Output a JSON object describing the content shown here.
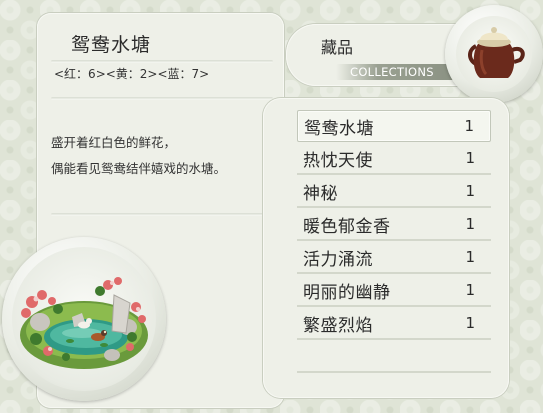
{
  "detail": {
    "title": "鸳鸯水塘",
    "stats": "<红：6><黄：2><蓝：7>",
    "description_line1": "盛开着红白色的鲜花，",
    "description_line2": "偶能看见鸳鸯结伴嬉戏的水塘。",
    "image_icon": "mandarin-duck-pond-illustration"
  },
  "collections": {
    "title": "藏品",
    "subtitle": "COLLECTIONS",
    "icon": "teapot-jar-icon"
  },
  "items": [
    {
      "name": "鸳鸯水塘",
      "count": "1",
      "selected": true
    },
    {
      "name": "热忱天使",
      "count": "1"
    },
    {
      "name": "神秘",
      "count": "1"
    },
    {
      "name": "暖色郁金香",
      "count": "1"
    },
    {
      "name": "活力涌流",
      "count": "1"
    },
    {
      "name": "明丽的幽静",
      "count": "1"
    },
    {
      "name": "繁盛烈焰",
      "count": "1"
    }
  ],
  "colors": {
    "background": "#dfe4d6",
    "panel": "#eef0e8",
    "jar": "#6b2a1c",
    "jar_lid": "#efe6c8"
  }
}
